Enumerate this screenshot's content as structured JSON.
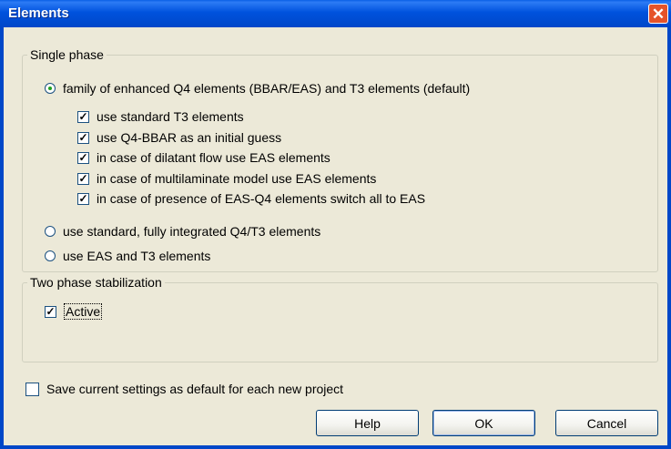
{
  "window": {
    "title": "Elements",
    "close_symbol": "✕"
  },
  "single_phase": {
    "legend": "Single phase",
    "option_enhanced": "family of enhanced Q4 elements (BBAR/EAS) and T3 elements (default)",
    "sub_options": [
      {
        "label": "use standard T3 elements",
        "checked": true
      },
      {
        "label": "use Q4-BBAR as an initial guess",
        "checked": true
      },
      {
        "label": "in case of dilatant flow use EAS elements",
        "checked": true
      },
      {
        "label": "in case of multilaminate model use EAS elements",
        "checked": true
      },
      {
        "label": "in case of presence of EAS-Q4 elements switch all to EAS",
        "checked": true
      }
    ],
    "option_standard": "use standard, fully integrated Q4/T3 elements",
    "option_eas": "use EAS and T3 elements",
    "selected": "option_enhanced"
  },
  "two_phase": {
    "legend": "Two phase stabilization",
    "active_label": "Active",
    "active_checked": true
  },
  "save_default": {
    "label": "Save current settings as default for each new project",
    "checked": false
  },
  "buttons": {
    "help": "Help",
    "ok": "OK",
    "cancel": "Cancel"
  },
  "check_mark": "✓",
  "colors": {
    "title_bar": "#0047c8",
    "close_button": "#e5532a",
    "dialog_bg": "#ece9d8"
  }
}
